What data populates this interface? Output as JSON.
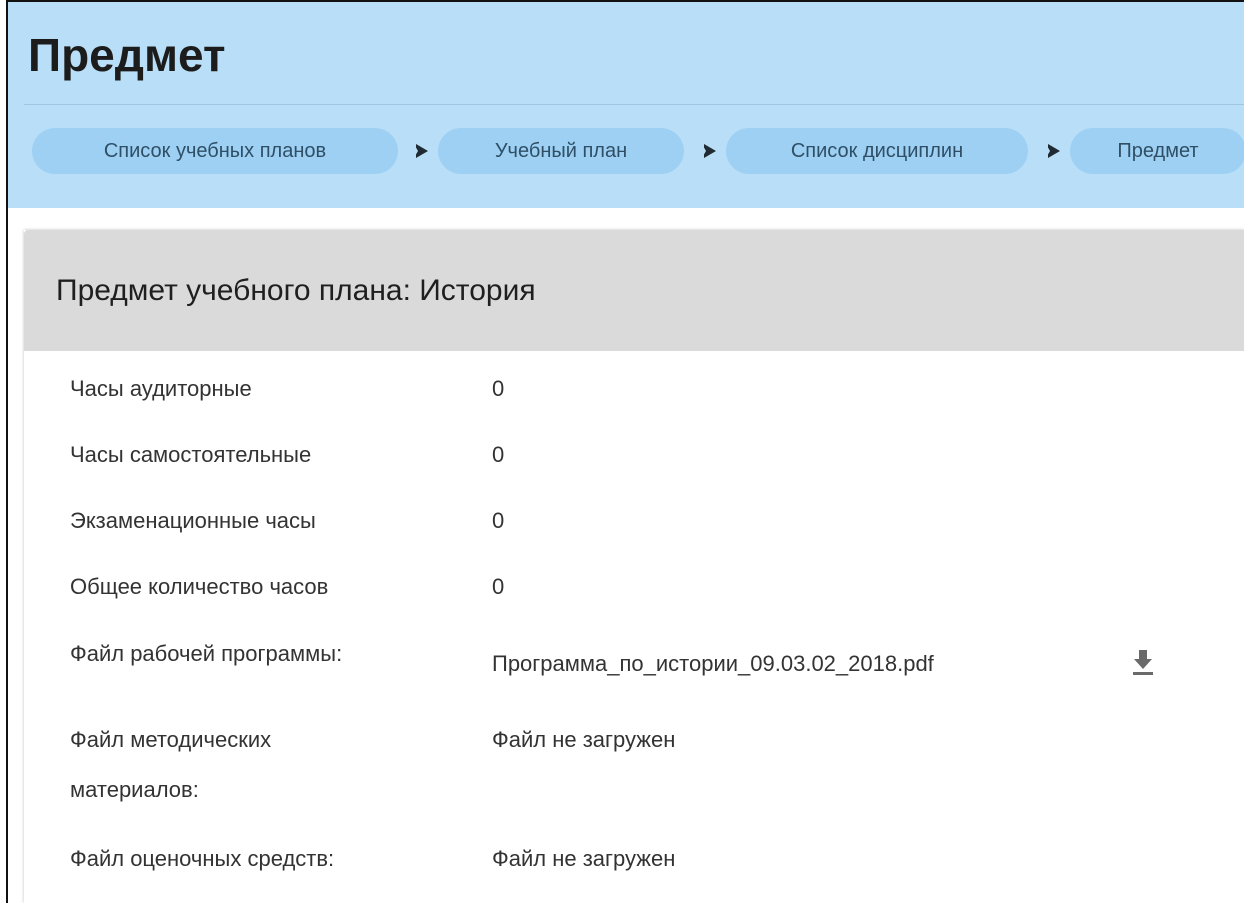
{
  "header": {
    "title": "Предмет",
    "breadcrumb": [
      {
        "label": "Список учебных планов"
      },
      {
        "label": "Учебный план"
      },
      {
        "label": "Список дисциплин"
      },
      {
        "label": "Предмет"
      }
    ]
  },
  "card": {
    "title": "Предмет учебного плана: История",
    "fields": [
      {
        "label": "Часы аудиторные",
        "value": "0"
      },
      {
        "label": "Часы самостоятельные",
        "value": "0"
      },
      {
        "label": "Экзаменационные часы",
        "value": "0"
      },
      {
        "label": "Общее количество часов",
        "value": "0"
      },
      {
        "label": "Файл рабочей программы:",
        "value": "Программа_по_истории_09.03.02_2018.pdf",
        "download_icon": "download-icon"
      },
      {
        "label_line1": "Файл методических",
        "label_line2": "материалов:",
        "value": "Файл не загружен"
      },
      {
        "label": "Файл оценочных средств:",
        "value": "Файл не загружен"
      }
    ]
  },
  "colors": {
    "header_bg": "#b9def7",
    "crumb_bg": "#9ed0f3",
    "card_header_bg": "#dadada"
  }
}
